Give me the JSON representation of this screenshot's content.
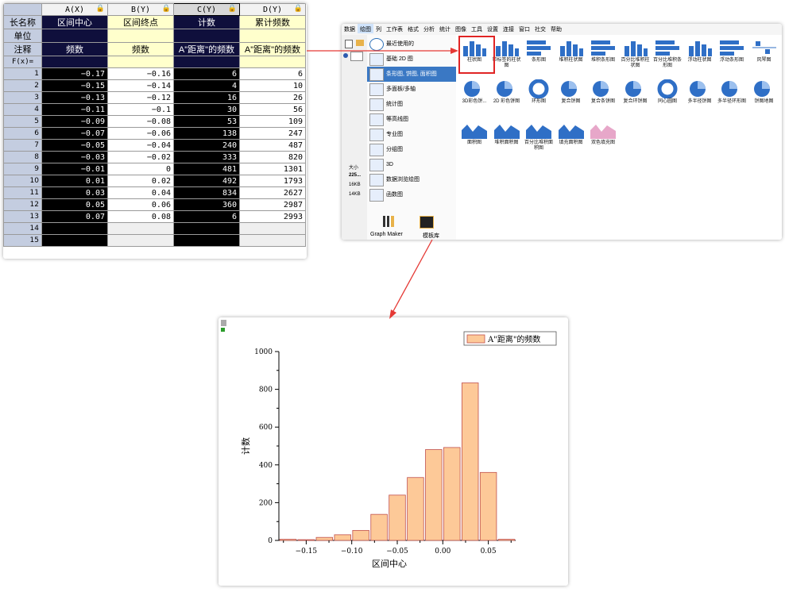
{
  "worksheet": {
    "columns": [
      {
        "header": "A(X)",
        "long_name": "区间中心",
        "unit": "",
        "comment": "频数"
      },
      {
        "header": "B(Y)",
        "long_name": "区间终点",
        "unit": "",
        "comment": "频数"
      },
      {
        "header": "C(Y)",
        "long_name": "计数",
        "unit": "",
        "comment": "A\"距离\"的频数"
      },
      {
        "header": "D(Y)",
        "long_name": "累计频数",
        "unit": "",
        "comment": "A\"距离\"的频数"
      }
    ],
    "row_labels": [
      "长名称",
      "单位",
      "注释",
      "F(x)="
    ],
    "rows": [
      [
        "1",
        "−0.17",
        "−0.16",
        "6",
        "6"
      ],
      [
        "2",
        "−0.15",
        "−0.14",
        "4",
        "10"
      ],
      [
        "3",
        "−0.13",
        "−0.12",
        "16",
        "26"
      ],
      [
        "4",
        "−0.11",
        "−0.1",
        "30",
        "56"
      ],
      [
        "5",
        "−0.09",
        "−0.08",
        "53",
        "109"
      ],
      [
        "6",
        "−0.07",
        "−0.06",
        "138",
        "247"
      ],
      [
        "7",
        "−0.05",
        "−0.04",
        "240",
        "487"
      ],
      [
        "8",
        "−0.03",
        "−0.02",
        "333",
        "820"
      ],
      [
        "9",
        "−0.01",
        "0",
        "481",
        "1301"
      ],
      [
        "10",
        "0.01",
        "0.02",
        "492",
        "1793"
      ],
      [
        "11",
        "0.03",
        "0.04",
        "834",
        "2627"
      ],
      [
        "12",
        "0.05",
        "0.06",
        "360",
        "2987"
      ],
      [
        "13",
        "0.07",
        "0.08",
        "6",
        "2993"
      ],
      [
        "14",
        "",
        "",
        "",
        ""
      ],
      [
        "15",
        "",
        "",
        "",
        ""
      ]
    ]
  },
  "menu": {
    "items": [
      "数据",
      "绘图",
      "列",
      "工作表",
      "格式",
      "分析",
      "统计",
      "图像",
      "工具",
      "设置",
      "连接",
      "窗口",
      "社交",
      "帮助"
    ],
    "active": "绘图",
    "left_info": [
      "大小",
      "225...",
      "16KB",
      "14KB"
    ],
    "categories": [
      {
        "label": "最近使用的"
      },
      {
        "label": "基础 2D 图"
      },
      {
        "label": "条形图, 饼图, 面积图"
      },
      {
        "label": "多面板/多轴"
      },
      {
        "label": "统计图"
      },
      {
        "label": "等高线图"
      },
      {
        "label": "专业图"
      },
      {
        "label": "分组图"
      },
      {
        "label": "3D"
      },
      {
        "label": "数据浏览绘图"
      },
      {
        "label": "函数图"
      }
    ],
    "bottom": [
      "Graph Maker",
      "模板库"
    ],
    "tiles": [
      "柱状图",
      "带标签的柱状图",
      "条形图",
      "堆积柱状图",
      "堆积条形图",
      "百分比堆积柱状图",
      "百分比堆积条形图",
      "浮动柱状图",
      "浮动条形图",
      "风琴图",
      "3D彩色饼...",
      "2D 彩色饼图",
      "环形图",
      "复合饼图",
      "复合条饼图",
      "复合环饼图",
      "同心圆图",
      "多半径饼图",
      "多半径环形图",
      "饼图地图",
      "面积图",
      "堆积面积图",
      "百分比堆积面积图",
      "填充面积图",
      "双色填充图"
    ]
  },
  "chart_data": {
    "type": "bar",
    "x": [
      -0.17,
      -0.15,
      -0.13,
      -0.11,
      -0.09,
      -0.07,
      -0.05,
      -0.03,
      -0.01,
      0.01,
      0.03,
      0.05,
      0.07
    ],
    "values": [
      6,
      4,
      16,
      30,
      53,
      138,
      240,
      333,
      481,
      492,
      834,
      360,
      6
    ],
    "xlabel": "区间中心",
    "ylabel": "计数",
    "legend": "A\"距离\"的频数",
    "legend_position": "top-right",
    "xlim": [
      -0.18,
      0.08
    ],
    "ylim": [
      0,
      1000
    ],
    "xticks": [
      -0.15,
      -0.1,
      -0.05,
      0.0,
      0.05
    ],
    "xtick_labels": [
      "−0.15",
      "−0.10",
      "−0.05",
      "0.00",
      "0.05"
    ],
    "yticks": [
      0,
      200,
      400,
      600,
      800,
      1000
    ],
    "ytick_labels": [
      "0",
      "200",
      "400",
      "600",
      "800",
      "1000"
    ],
    "bar_color": "#fdc998",
    "bar_edge": "#c0504d"
  },
  "colors": {
    "arrow": "#e53935",
    "accent": "#3a78c4"
  }
}
